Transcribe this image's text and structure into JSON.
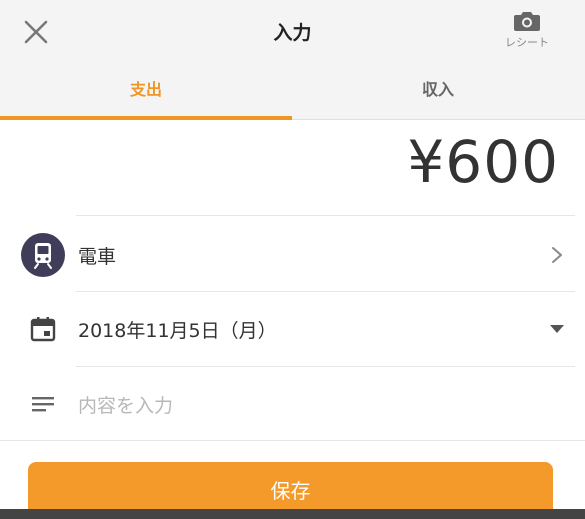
{
  "header": {
    "title": "入力",
    "receipt_label": "レシート",
    "icons": {
      "close": "close-icon",
      "receipt": "camera-icon"
    }
  },
  "tabs": [
    {
      "label": "支出",
      "active": true
    },
    {
      "label": "収入",
      "active": false
    }
  ],
  "amount": "¥600",
  "category": {
    "label": "電車",
    "icon": "train-icon"
  },
  "date": {
    "value": "2018年11月5日（月）",
    "icon": "calendar-icon"
  },
  "memo": {
    "placeholder": "内容を入力",
    "icon": "notes-icon"
  },
  "save_label": "保存",
  "colors": {
    "accent": "#f09624",
    "category_bg": "#3f3d5a"
  }
}
